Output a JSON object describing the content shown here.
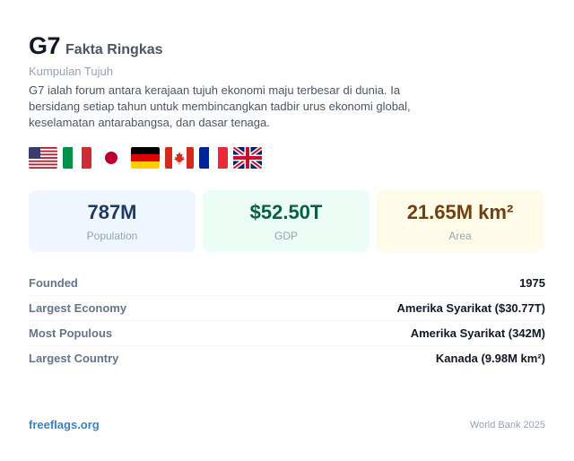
{
  "header": {
    "title": "G7",
    "subtitle": "Fakta Ringkas",
    "alt_name": "Kumpulan Tujuh",
    "description": "G7 ialah forum antara kerajaan tujuh ekonomi maju terbesar di dunia. Ia bersidang setiap tahun untuk membincangkan tadbir urus ekonomi global, keselamatan antarabangsa, dan dasar tenaga."
  },
  "flags": [
    {
      "icon": "us-flag-icon"
    },
    {
      "icon": "it-flag-icon"
    },
    {
      "icon": "jp-flag-icon"
    },
    {
      "icon": "de-flag-icon"
    },
    {
      "icon": "ca-flag-icon"
    },
    {
      "icon": "fr-flag-icon"
    },
    {
      "icon": "gb-flag-icon"
    }
  ],
  "stats": {
    "population": {
      "value": "787M",
      "label": "Population"
    },
    "gdp": {
      "value": "$52.50T",
      "label": "GDP"
    },
    "area": {
      "value": "21.65M km²",
      "label": "Area"
    }
  },
  "facts": [
    {
      "key": "Founded",
      "value": "1975"
    },
    {
      "key": "Largest Economy",
      "value": "Amerika Syarikat ($30.77T)"
    },
    {
      "key": "Most Populous",
      "value": "Amerika Syarikat (342M)"
    },
    {
      "key": "Largest Country",
      "value": "Kanada (9.98M km²)"
    }
  ],
  "footer": {
    "site": "freeflags.org",
    "source": "World Bank 2025"
  },
  "colors": {
    "accent_link": "#3b82c4",
    "population_bg": "#eff6ff",
    "gdp_bg": "#ecfdf5",
    "area_bg": "#fefce8"
  }
}
